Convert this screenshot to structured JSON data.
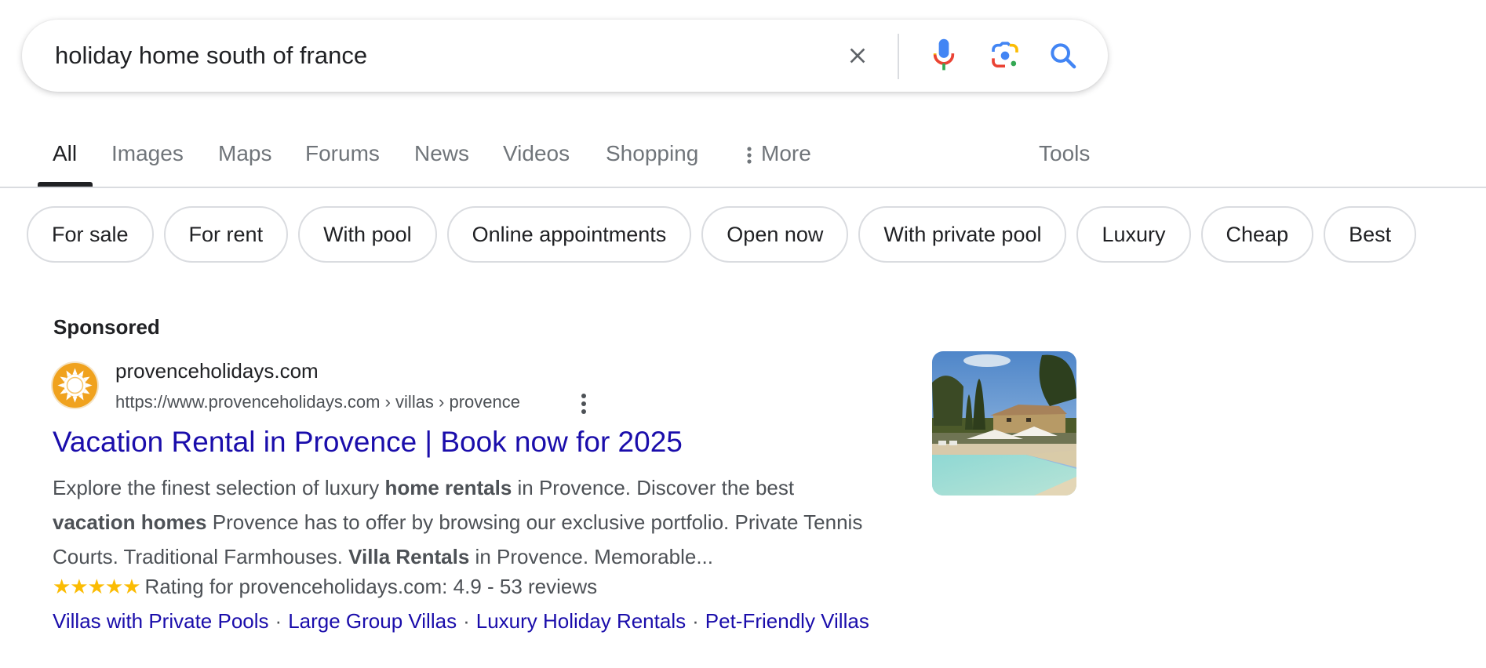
{
  "search": {
    "query": "holiday home south of france",
    "icons": [
      "close-icon",
      "microphone-icon",
      "google-lens-icon",
      "search-icon"
    ]
  },
  "tabs": [
    {
      "label": "All",
      "active": true
    },
    {
      "label": "Images"
    },
    {
      "label": "Maps"
    },
    {
      "label": "Forums"
    },
    {
      "label": "News"
    },
    {
      "label": "Videos"
    },
    {
      "label": "Shopping"
    },
    {
      "label": "More",
      "icon": "more-vert-icon"
    },
    {
      "label": "Tools"
    }
  ],
  "chips": [
    "For sale",
    "For rent",
    "With pool",
    "Online appointments",
    "Open now",
    "With private pool",
    "Luxury",
    "Cheap",
    "Best"
  ],
  "ad": {
    "section_label": "Sponsored",
    "site_name": "provenceholidays.com",
    "display_url": "https://www.provenceholidays.com › villas › provence",
    "title": "Vacation Rental in Provence | Book now for 2025",
    "description": [
      {
        "text": "Explore the finest selection of luxury ",
        "bold": false
      },
      {
        "text": "home rentals",
        "bold": true
      },
      {
        "text": " in Provence. Discover the best ",
        "bold": false
      },
      {
        "text": "vacation homes",
        "bold": true
      },
      {
        "text": " Provence has to offer by browsing our exclusive portfolio. Private Tennis Courts. Traditional Farmhouses. ",
        "bold": false
      },
      {
        "text": "Villa Rentals",
        "bold": true
      },
      {
        "text": " in Provence. Memorable...",
        "bold": false
      }
    ],
    "rating": {
      "stars_glyph": "★★★★★",
      "stars": 5,
      "text": "Rating for provenceholidays.com: 4.9 - 53 reviews",
      "value": 4.9,
      "reviews": 53
    },
    "sitelinks": [
      "Villas with Private Pools",
      "Large Group Villas",
      "Luxury Holiday Rentals",
      "Pet-Friendly Villas"
    ],
    "sitelink_separator": "·",
    "thumbnail": "villa-with-pool-image"
  },
  "colors": {
    "link": "#1a0dab",
    "snippet": "#4d5156",
    "star": "#fbbc04",
    "favicon": "#f0a21e"
  }
}
